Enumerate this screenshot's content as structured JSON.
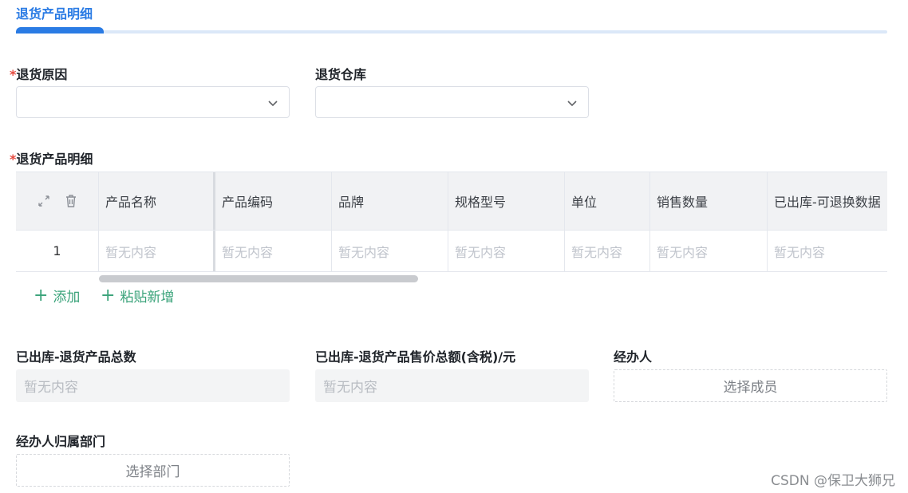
{
  "section": {
    "title": "退货产品明细"
  },
  "form": {
    "reason": {
      "required_mark": "*",
      "label": "退货原因",
      "value": ""
    },
    "warehouse": {
      "label": "退货仓库",
      "value": ""
    },
    "detail_label": {
      "required_mark": "*",
      "label": "退货产品明细"
    }
  },
  "table": {
    "columns": [
      "产品名称",
      "产品编码",
      "品牌",
      "规格型号",
      "单位",
      "销售数量",
      "已出库-可退换数据"
    ],
    "rows": [
      {
        "index": "1",
        "cells": [
          "暂无内容",
          "暂无内容",
          "暂无内容",
          "暂无内容",
          "暂无内容",
          "暂无内容",
          "暂无内容"
        ]
      }
    ],
    "expand_icon": "expand-icon",
    "delete_icon": "trash-icon"
  },
  "actions": {
    "add": "添加",
    "paste_add": "粘贴新增"
  },
  "summary": {
    "total_count": {
      "label": "已出库-退货产品总数",
      "value": "暂无内容"
    },
    "total_amount": {
      "label": "已出库-退货产品售价总额(含税)/元",
      "value": "暂无内容"
    },
    "handler": {
      "label": "经办人",
      "button": "选择成员"
    },
    "department": {
      "label": "经办人归属部门",
      "button": "选择部门"
    }
  },
  "watermark": "CSDN @保卫大狮兄",
  "colors": {
    "accent": "#2a7be4",
    "link": "#3aa37a",
    "required": "#e5483e"
  }
}
